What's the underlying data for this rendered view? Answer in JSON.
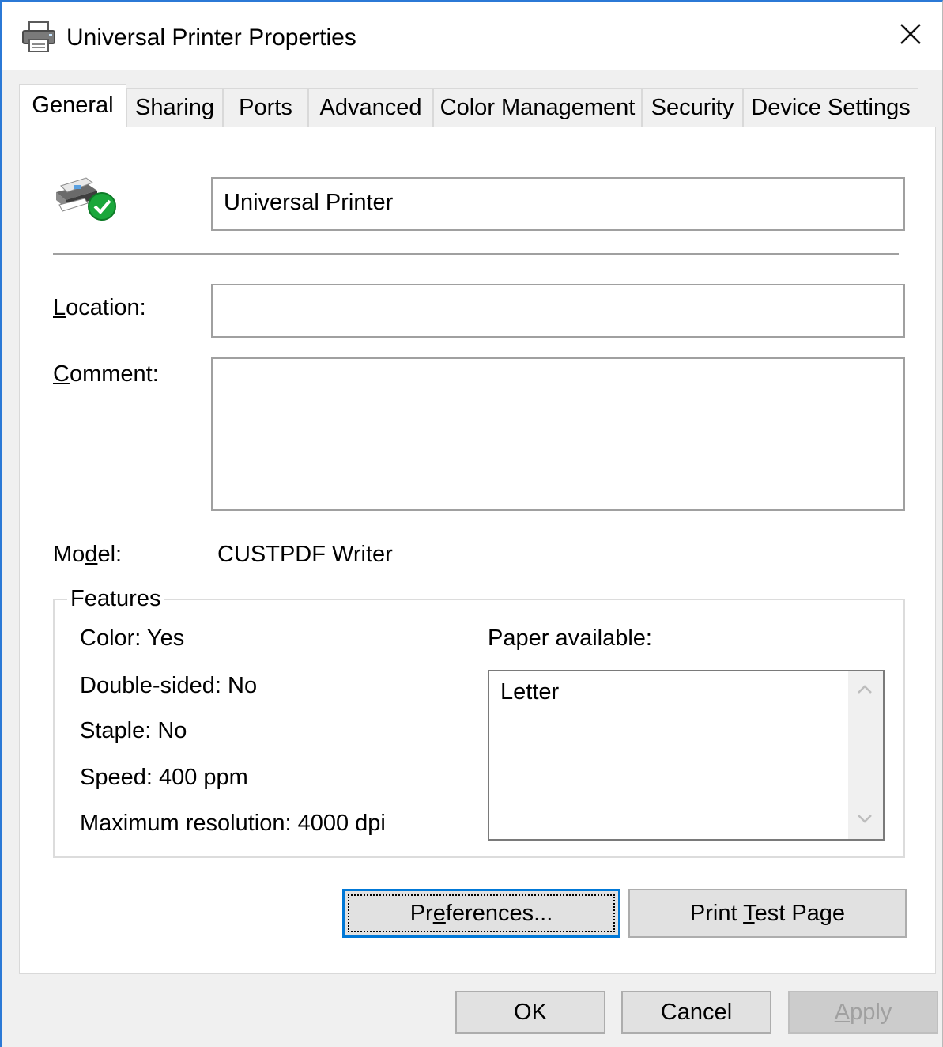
{
  "window": {
    "title": "Universal Printer Properties"
  },
  "tabs": [
    {
      "label": "General",
      "active": true
    },
    {
      "label": "Sharing",
      "active": false
    },
    {
      "label": "Ports",
      "active": false
    },
    {
      "label": "Advanced",
      "active": false
    },
    {
      "label": "Color Management",
      "active": false
    },
    {
      "label": "Security",
      "active": false
    },
    {
      "label": "Device Settings",
      "active": false
    }
  ],
  "general": {
    "printer_name": "Universal Printer",
    "location_label": "Location:",
    "location_value": "",
    "comment_label": "Comment:",
    "comment_value": "",
    "model_label": "Model:",
    "model_value": "CUSTPDF Writer"
  },
  "features": {
    "title": "Features",
    "color": "Color: Yes",
    "double_sided": "Double-sided: No",
    "staple": "Staple: No",
    "speed": "Speed: 400 ppm",
    "max_resolution": "Maximum resolution: 4000 dpi",
    "paper_label": "Paper available:",
    "paper_items": [
      "Letter"
    ]
  },
  "buttons": {
    "preferences": "Preferences...",
    "print_test_page": "Print Test Page",
    "ok": "OK",
    "cancel": "Cancel",
    "apply": "Apply"
  },
  "icons": {
    "title": "printer-icon",
    "close": "close-icon",
    "printer_status": "printer-ready-icon",
    "scroll_up": "chevron-up-icon",
    "scroll_down": "chevron-down-icon"
  },
  "colors": {
    "accent": "#0078d7",
    "status_ok": "#1aa73b"
  }
}
